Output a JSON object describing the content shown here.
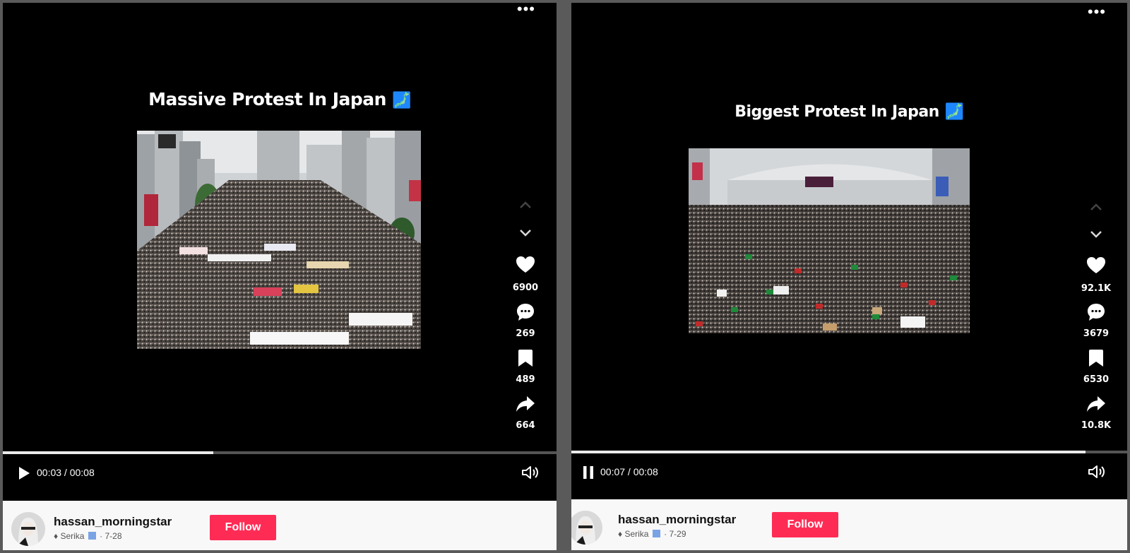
{
  "posts": [
    {
      "caption": "Massive Protest In Japan",
      "caption_emoji": "🗾",
      "stats": {
        "likes": "6900",
        "comments": "269",
        "saves": "489",
        "shares": "664"
      },
      "playback": {
        "time": "00:03 / 00:08",
        "state": "paused",
        "progress": 0.38
      },
      "author": {
        "username": "hassan_morningstar",
        "sub_prefix": "♦ Serika",
        "date": "· 7-28"
      },
      "follow_label": "Follow"
    },
    {
      "caption": "Biggest Protest In Japan",
      "caption_emoji": "🗾",
      "stats": {
        "likes": "92.1K",
        "comments": "3679",
        "saves": "6530",
        "shares": "10.8K"
      },
      "playback": {
        "time": "00:07 / 00:08",
        "state": "playing",
        "progress": 0.925
      },
      "author": {
        "username": "hassan_morningstar",
        "sub_prefix": "♦ Serika",
        "date": "· 7-29"
      },
      "follow_label": "Follow"
    }
  ],
  "icons": {
    "more": "more-dots-icon",
    "up": "chevron-up-icon",
    "down": "chevron-down-icon",
    "like": "heart-icon",
    "comment": "comment-bubble-icon",
    "save": "bookmark-icon",
    "share": "share-arrow-icon",
    "play": "play-icon",
    "pause": "pause-icon",
    "volume": "volume-icon"
  },
  "colors": {
    "follow_button": "#fe2c55",
    "progress_fill": "#eaeaea",
    "map_emoji": "#8fcf3a"
  }
}
